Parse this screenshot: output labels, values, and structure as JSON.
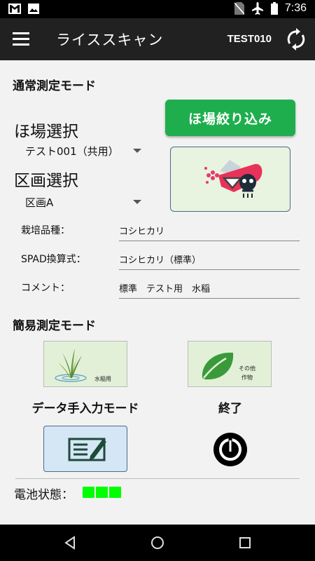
{
  "status_bar": {
    "time": "7:36"
  },
  "toolbar": {
    "title": "ライススキャン",
    "user_id": "TEST010"
  },
  "normal_mode": {
    "title": "通常測定モード",
    "field_select_label": "ほ場選択",
    "field_select_value": "テスト001（共用）",
    "block_select_label": "区画選択",
    "block_select_value": "区画A",
    "filter_button": "ほ場絞り込み",
    "variety_label": "栽培品種：",
    "variety_value": "コシヒカリ",
    "spad_label": "SPAD換算式：",
    "spad_value": "コシヒカリ（標準）",
    "comment_label": "コメント：",
    "comment_value": "標準　テスト用　水稲"
  },
  "simple_mode": {
    "title": "簡易測定モード",
    "rice_caption": "水稲用",
    "other_caption_line1": "その他",
    "other_caption_line2": "作物"
  },
  "manual_input_label": "データ手入力モード",
  "exit_label": "終了",
  "battery": {
    "label": "電池状態：",
    "level_cells": 3,
    "color": "#00ff00"
  },
  "colors": {
    "accent_green": "#1fae4d",
    "toolbar_bg": "#212121"
  },
  "icons": [
    "gmail-icon",
    "image-icon",
    "no-sim-icon",
    "airplane-icon",
    "battery-icon",
    "menu-icon",
    "sync-icon",
    "scanner-icon",
    "rice-plant-icon",
    "leaf-icon",
    "pen-note-icon",
    "power-icon",
    "back-icon",
    "home-icon",
    "recents-icon"
  ]
}
